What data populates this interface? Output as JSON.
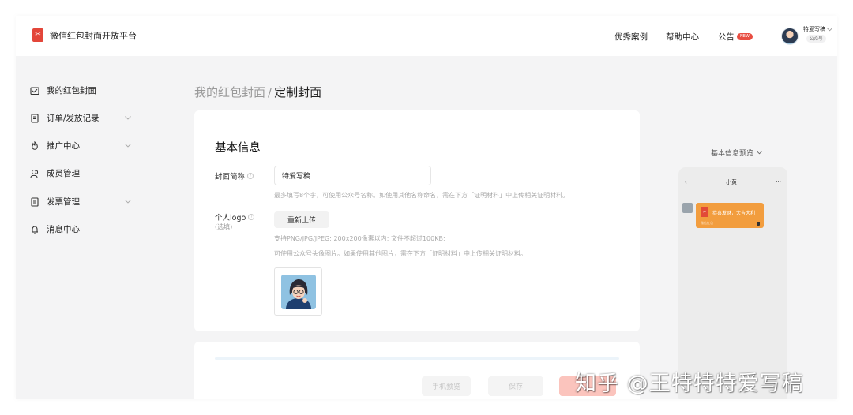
{
  "app": {
    "title": "微信红包封面开放平台",
    "brand_color": "#e3463a"
  },
  "topnav": {
    "cases": "优秀案例",
    "help": "帮助中心",
    "notice": "公告",
    "notice_badge": "NEW"
  },
  "account": {
    "name": "特爱写稿",
    "type": "公众号"
  },
  "sidebar": {
    "items": [
      {
        "label": "我的红包封面",
        "icon": "envelope-icon"
      },
      {
        "label": "订单/发放记录",
        "icon": "order-icon",
        "expandable": true
      },
      {
        "label": "推广中心",
        "icon": "promotion-icon",
        "expandable": true
      },
      {
        "label": "成员管理",
        "icon": "members-icon"
      },
      {
        "label": "发票管理",
        "icon": "invoice-icon",
        "expandable": true
      },
      {
        "label": "消息中心",
        "icon": "bell-icon"
      }
    ]
  },
  "breadcrumb": {
    "parent": "我的红包封面",
    "separator": "/",
    "current": "定制封面"
  },
  "form": {
    "section_title": "基本信息",
    "cover_name": {
      "label": "封面简称",
      "value": "特爱写稿",
      "hint": "最多填写8个字，可使用公众号名称。如使用其他名称命名，需在下方「证明材料」中上传相关证明材料。"
    },
    "logo": {
      "label": "个人logo",
      "sub_label": "(选填)",
      "button": "重新上传",
      "hint_1": "支持PNG/JPG/JPEG; 200x200像素以内; 文件不超过100KB;",
      "hint_2": "可使用公众号头像图片。如果使用其他图片，需在下方「证明材料」中上传相关证明材料。"
    }
  },
  "actions": {
    "preview": "手机预览",
    "save": "保存",
    "submit": ""
  },
  "preview": {
    "label": "基本信息预览",
    "chat_title": "小黄",
    "back": "‹",
    "more": "···",
    "packet_text": "恭喜发财，大吉大利",
    "packet_footer": "微信红包",
    "packet_color": "#f29d3e"
  },
  "watermark": "知乎 @王特特特爱写稿"
}
